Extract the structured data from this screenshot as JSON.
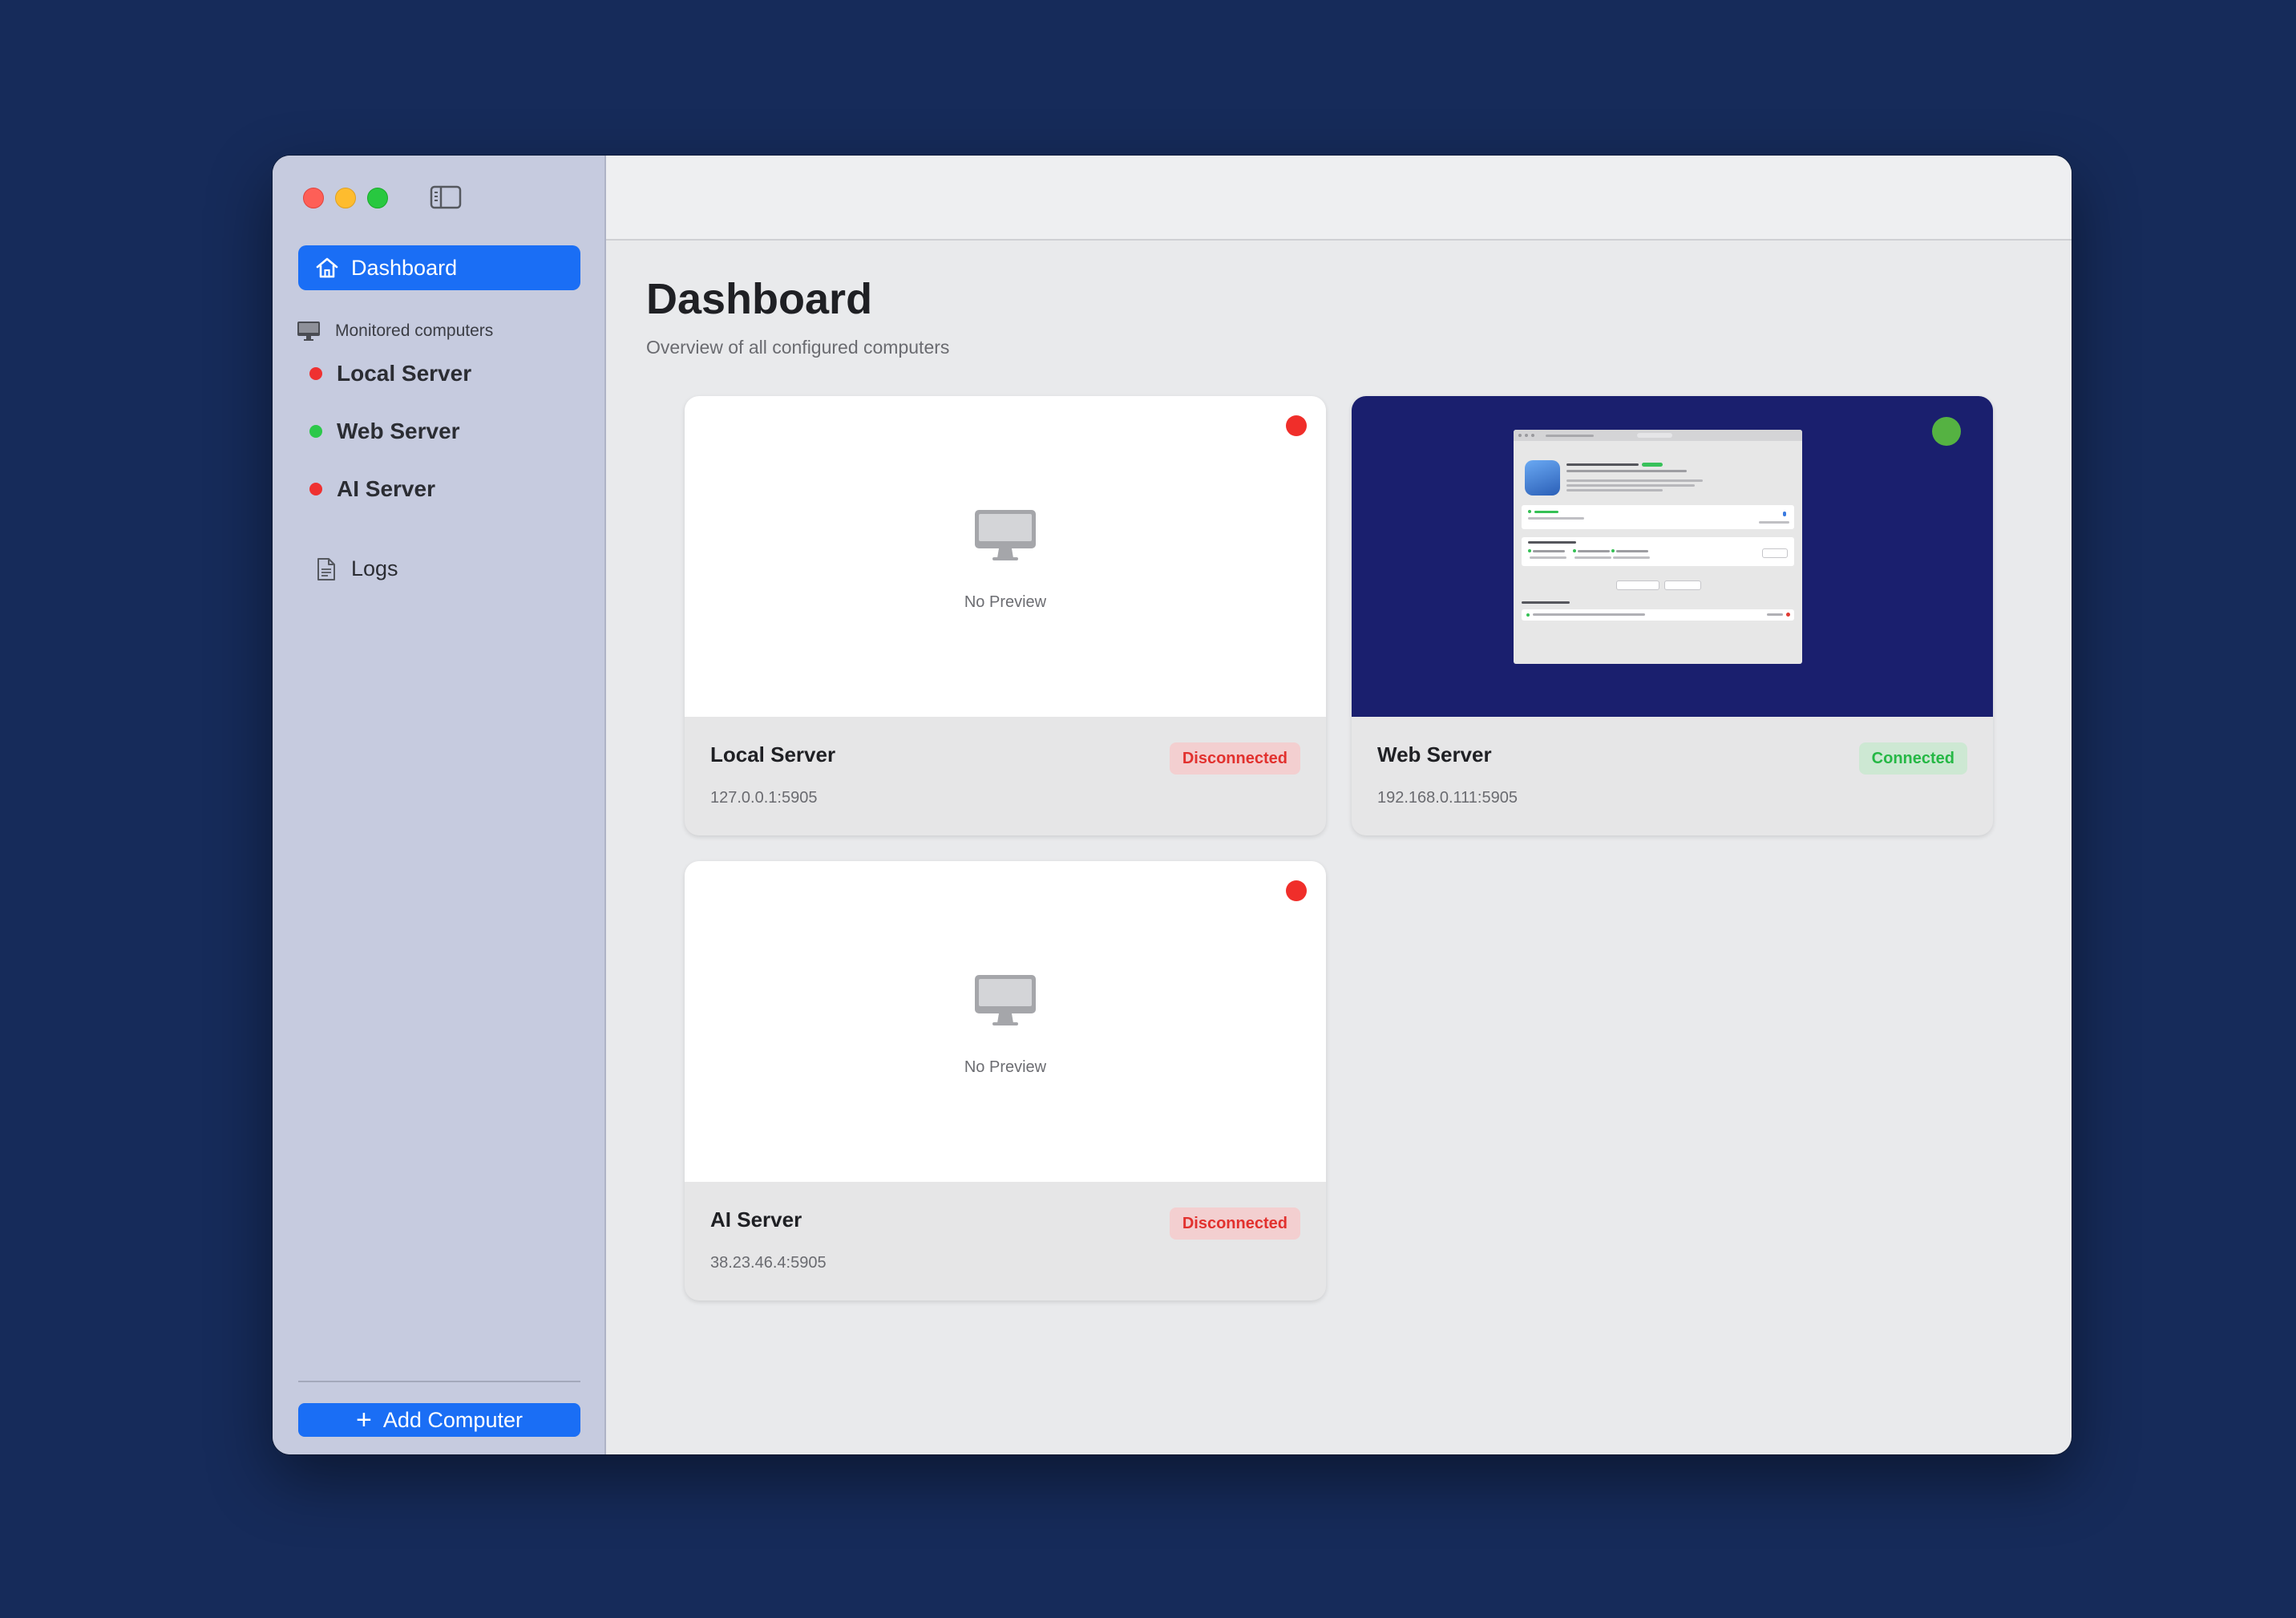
{
  "sidebar": {
    "dashboard_label": "Dashboard",
    "section_title": "Monitored computers",
    "computers": [
      {
        "label": "Local Server",
        "status": "disconnected",
        "color": "#ef3131"
      },
      {
        "label": "Web Server",
        "status": "connected",
        "color": "#2cc84a"
      },
      {
        "label": "AI Server",
        "status": "disconnected",
        "color": "#ef3131"
      }
    ],
    "logs_label": "Logs",
    "add_button_label": "Add Computer"
  },
  "main": {
    "title": "Dashboard",
    "subtitle": "Overview of all configured computers"
  },
  "cards": [
    {
      "name": "Local Server",
      "address": "127.0.0.1:5905",
      "status": "Disconnected",
      "preview_text": "No Preview"
    },
    {
      "name": "Web Server",
      "address": "192.168.0.111:5905",
      "status": "Connected"
    },
    {
      "name": "AI Server",
      "address": "38.23.46.4:5905",
      "status": "Disconnected",
      "preview_text": "No Preview"
    }
  ],
  "colors": {
    "accent": "#1a6ef5",
    "disconnected": "#e2312e",
    "connected": "#25b845",
    "desktop_background": "#162b5a"
  },
  "icons": {
    "dashboard": "house-icon",
    "section": "monitor-icon",
    "logs": "document-icon",
    "add": "plus-icon"
  }
}
